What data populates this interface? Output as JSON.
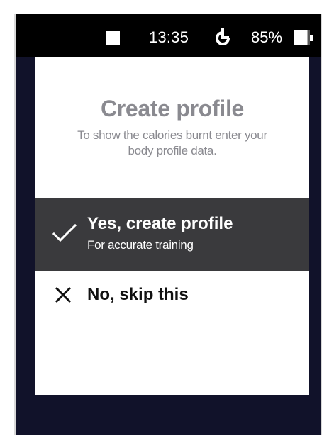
{
  "status_bar": {
    "time": "13:35",
    "battery_percent": "85%",
    "icons": [
      "square-indicator-icon",
      "sync-icon",
      "battery-icon"
    ],
    "battery_level": 0.85
  },
  "dialog": {
    "title": "Create profile",
    "subtitle": "To show the calories burnt enter your body profile data.",
    "options": [
      {
        "label": "Yes, create profile",
        "sublabel": "For accurate training",
        "icon": "check-icon",
        "selected": true
      },
      {
        "label": "No, skip this",
        "icon": "close-icon",
        "selected": false
      }
    ]
  },
  "colors": {
    "screen_background": "#11122a",
    "status_bar": "#000000",
    "dialog": "#ffffff",
    "selected_option": "#3a3a3d",
    "title_text": "#8a8a90"
  }
}
